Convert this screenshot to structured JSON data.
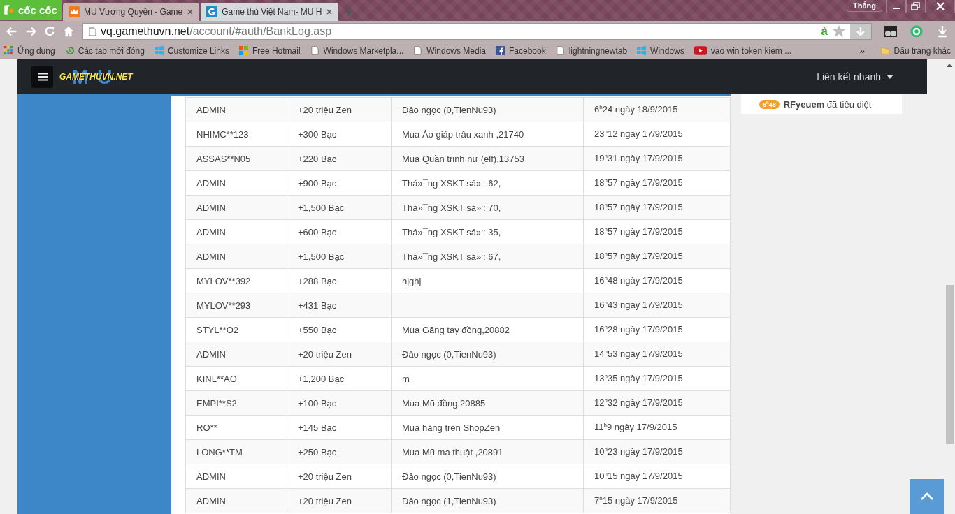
{
  "browser": {
    "logo": "cốc cốc",
    "tabs": [
      {
        "title": "MU Vương Quyền - Game",
        "selected": false
      },
      {
        "title": "Game thủ Việt Nam- MU H",
        "selected": true
      }
    ],
    "user": "Thắng",
    "url_host": "vq.gamethuvn.net",
    "url_path": "/account/#auth/BankLog.asp",
    "ime": "à",
    "bookmarks": [
      {
        "label": "Ứng dụng"
      },
      {
        "label": "Các tab mới đóng"
      },
      {
        "label": "Customize Links"
      },
      {
        "label": "Free Hotmail"
      },
      {
        "label": "Windows Marketpla..."
      },
      {
        "label": "Windows Media"
      },
      {
        "label": "Facebook"
      },
      {
        "label": "lightningnewtab"
      },
      {
        "label": "Windows"
      },
      {
        "label": "vao win token kiem ..."
      }
    ],
    "more": "»",
    "other_bookmarks": "Dấu trang khác"
  },
  "site": {
    "logo_word": "GAMETHUVN.NET",
    "logo_mark": "MU",
    "quick_links": "Liên kết nhanh"
  },
  "notice": {
    "time": "6$^{h}$48",
    "user": "RFyeuem",
    "text": "đã tiêu diệt"
  },
  "rows": [
    [
      "ADMIN",
      "+20  triệu Zen",
      "Đảo ngọc (0,TienNu93)",
      "6$^{h}$24 ngày 18/9/2015"
    ],
    [
      "NHIMC**123",
      "+300  Bạc",
      "Mua Áo giáp trâu xanh ,21740",
      "23$^{h}$12 ngày 17/9/2015"
    ],
    [
      "ASSAS**N05",
      "+220  Bạc",
      "Mua Quần trinh nữ (elf),13753",
      "19$^{h}$31 ngày 17/9/2015"
    ],
    [
      "ADMIN",
      "+900  Bạc",
      "Thá»¯ng XSKT sá»‘: 62,",
      "18$^{h}$57 ngày 17/9/2015"
    ],
    [
      "ADMIN",
      "+1,500  Bạc",
      "Thá»¯ng XSKT sá»‘: 70,",
      "18$^{h}$57 ngày 17/9/2015"
    ],
    [
      "ADMIN",
      "+600  Bạc",
      "Thá»¯ng XSKT sá»‘: 35,",
      "18$^{h}$57 ngày 17/9/2015"
    ],
    [
      "ADMIN",
      "+1,500  Bạc",
      "Thá»¯ng XSKT sá»‘: 67,",
      "18$^{h}$57 ngày 17/9/2015"
    ],
    [
      "MYLOV**392",
      "+288  Bạc",
      "hjghj",
      "16$^{h}$48 ngày 17/9/2015"
    ],
    [
      "MYLOV**293",
      "+431  Bạc",
      "",
      "16$^{h}$43 ngày 17/9/2015"
    ],
    [
      "STYL**O2",
      "+550  Bạc",
      "Mua Găng tay đồng,20882",
      "16$^{h}$28 ngày 17/9/2015"
    ],
    [
      "ADMIN",
      "+20  triệu Zen",
      "Đảo ngọc (0,TienNu93)",
      "14$^{h}$53 ngày 17/9/2015"
    ],
    [
      "KINL**AO",
      "+1,200  Bạc",
      "m",
      "13$^{h}$35 ngày 17/9/2015"
    ],
    [
      "EMPI**S2",
      "+100  Bạc",
      "Mua Mũ đồng,20885",
      "12$^{h}$32 ngày 17/9/2015"
    ],
    [
      "RO**",
      "+145  Bạc",
      "Mua hàng trên ShopZen",
      "11$^{h}$9 ngày 17/9/2015"
    ],
    [
      "LONG**TM",
      "+250  Bạc",
      "Mua Mũ ma thuật ,20891",
      "10$^{h}$23 ngày 17/9/2015"
    ],
    [
      "ADMIN",
      "+20  triệu Zen",
      "Đảo ngọc (0,TienNu93)",
      "10$^{h}$15 ngày 17/9/2015"
    ],
    [
      "ADMIN",
      "+20  triệu Zen",
      "Đảo ngọc (1,TienNu93)",
      "7$^{h}$15 ngày 17/9/2015"
    ]
  ]
}
